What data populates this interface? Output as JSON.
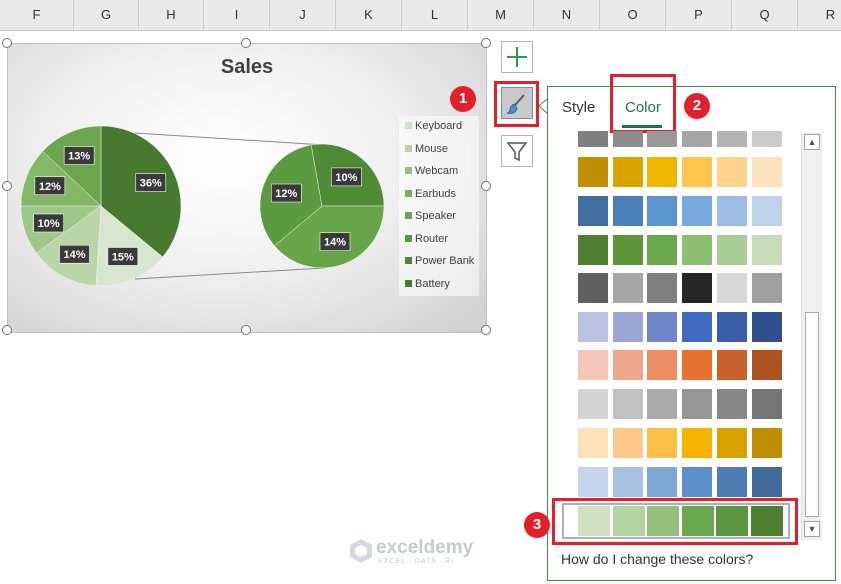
{
  "columns": [
    "F",
    "G",
    "H",
    "I",
    "J",
    "K",
    "L",
    "M",
    "N",
    "O",
    "P",
    "Q",
    "R"
  ],
  "chart": {
    "title": "Sales",
    "legend": [
      {
        "label": "Keyboard",
        "color": "#cfe2c3"
      },
      {
        "label": "Mouse",
        "color": "#b3d3a0"
      },
      {
        "label": "Webcam",
        "color": "#93c07a"
      },
      {
        "label": "Earbuds",
        "color": "#78b057"
      },
      {
        "label": "Speaker",
        "color": "#6aa84f"
      },
      {
        "label": "Router",
        "color": "#5a9a3e"
      },
      {
        "label": "Power Bank",
        "color": "#4c8a33"
      },
      {
        "label": "Battery",
        "color": "#437a2e"
      }
    ]
  },
  "chart_data": {
    "type": "pie",
    "title": "Sales",
    "primary_slices": [
      {
        "value": 36,
        "label": "36%",
        "color": "#467b2f"
      },
      {
        "value": 15,
        "label": "15%",
        "color": "#d8e6cf"
      },
      {
        "value": 14,
        "label": "14%",
        "color": "#b9d6a6"
      },
      {
        "value": 10,
        "label": "10%",
        "color": "#9ec88a"
      },
      {
        "value": 12,
        "label": "12%",
        "color": "#83b867"
      },
      {
        "value": 13,
        "label": "13%",
        "color": "#6ba54c"
      }
    ],
    "secondary_slices": [
      {
        "value": 12,
        "label": "12%",
        "color": "#5c9a3f"
      },
      {
        "value": 10,
        "label": "10%",
        "color": "#4f8a35"
      },
      {
        "value": 14,
        "label": "14%",
        "color": "#68a449"
      }
    ]
  },
  "side_buttons": {
    "add_element": "+",
    "styles": "brush",
    "filter": "funnel"
  },
  "annotations": {
    "badge1": "1",
    "badge2": "2",
    "badge3": "3"
  },
  "panel": {
    "tab_style": "Style",
    "tab_color": "Color",
    "help": "How do I change these colors?",
    "rows": [
      [
        "#7f7f7f",
        "#8c8c8c",
        "#999999",
        "#a6a6a6",
        "#b3b3b3",
        "#cccccc"
      ],
      [
        "#bf9000",
        "#d9a400",
        "#f0b800",
        "#ffc54d",
        "#ffd38a",
        "#fde2c0"
      ],
      [
        "#3f6e9f",
        "#4a80b8",
        "#5b95cf",
        "#78a9dc",
        "#9dbde3",
        "#bfd2ec"
      ],
      [
        "#4d7e31",
        "#5d9639",
        "#6aa84f",
        "#8cbf72",
        "#a8cd95",
        "#c6ddb9"
      ],
      [
        "#606060",
        "#a6a6a6",
        "#808080",
        "#262626",
        "#d9d9d9",
        "#a0a0a0"
      ],
      [
        "#b8c3e3",
        "#9aa7d6",
        "#6d87c8",
        "#3e6bbf",
        "#3a5fa6",
        "#2f4f8c"
      ],
      [
        "#f4c6b5",
        "#efa98a",
        "#ec8d62",
        "#e57230",
        "#c9622a",
        "#ad5222"
      ],
      [
        "#d4d4d4",
        "#c0c0c0",
        "#ababab",
        "#969696",
        "#878787",
        "#767676"
      ],
      [
        "#fde0b8",
        "#fdc98a",
        "#fcbf47",
        "#f6b400",
        "#d9a200",
        "#bf8f00"
      ],
      [
        "#c6d6ec",
        "#a9c2e4",
        "#7fa7d6",
        "#5b8fc8",
        "#4d7cb1",
        "#416a99"
      ],
      [
        "#cfe2c3",
        "#b3d3a0",
        "#93c07a",
        "#6aa84f",
        "#5b9640",
        "#4c7f2f"
      ]
    ]
  },
  "watermark": {
    "name": "exceldemy",
    "tagline": "EXCEL · DATA · BI"
  }
}
